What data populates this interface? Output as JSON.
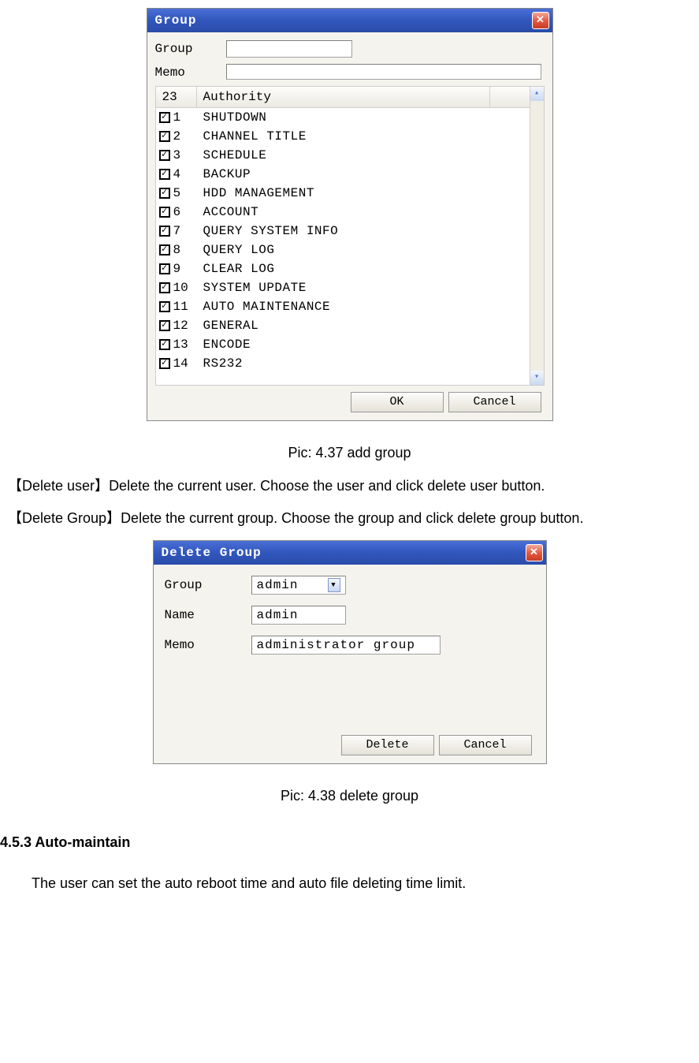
{
  "groupDialog": {
    "title": "Group",
    "fields": {
      "groupLabel": "Group",
      "memoLabel": "Memo",
      "groupValue": "",
      "memoValue": ""
    },
    "listHeader": {
      "countCol": "23",
      "authCol": "Authority"
    },
    "authorities": [
      {
        "n": "1",
        "label": "SHUTDOWN"
      },
      {
        "n": "2",
        "label": "CHANNEL TITLE"
      },
      {
        "n": "3",
        "label": "SCHEDULE"
      },
      {
        "n": "4",
        "label": "BACKUP"
      },
      {
        "n": "5",
        "label": "HDD MANAGEMENT"
      },
      {
        "n": "6",
        "label": "ACCOUNT"
      },
      {
        "n": "7",
        "label": "QUERY SYSTEM INFO"
      },
      {
        "n": "8",
        "label": "QUERY LOG"
      },
      {
        "n": "9",
        "label": "CLEAR LOG"
      },
      {
        "n": "10",
        "label": "SYSTEM UPDATE"
      },
      {
        "n": "11",
        "label": "AUTO MAINTENANCE"
      },
      {
        "n": "12",
        "label": "GENERAL"
      },
      {
        "n": "13",
        "label": "ENCODE"
      },
      {
        "n": "14",
        "label": "RS232"
      }
    ],
    "buttons": {
      "ok": "OK",
      "cancel": "Cancel"
    }
  },
  "caption1": "Pic: 4.37 add group",
  "text": {
    "deleteUserHead": "【Delete user】",
    "deleteUserBody": "Delete the current user. Choose the user and click delete user button.",
    "deleteGroupHead": "【Delete Group】",
    "deleteGroupBody": "Delete the current group. Choose the group and click delete group button."
  },
  "deleteDialog": {
    "title": "Delete Group",
    "fields": {
      "groupLabel": "Group",
      "groupValue": "admin",
      "nameLabel": "Name",
      "nameValue": "admin",
      "memoLabel": "Memo",
      "memoValue": "administrator group"
    },
    "buttons": {
      "delete": "Delete",
      "cancel": "Cancel"
    }
  },
  "caption2": "Pic: 4.38 delete group",
  "section": {
    "head": "4.5.3 Auto-maintain",
    "body": "The user can set the auto reboot time and auto file deleting time limit."
  }
}
